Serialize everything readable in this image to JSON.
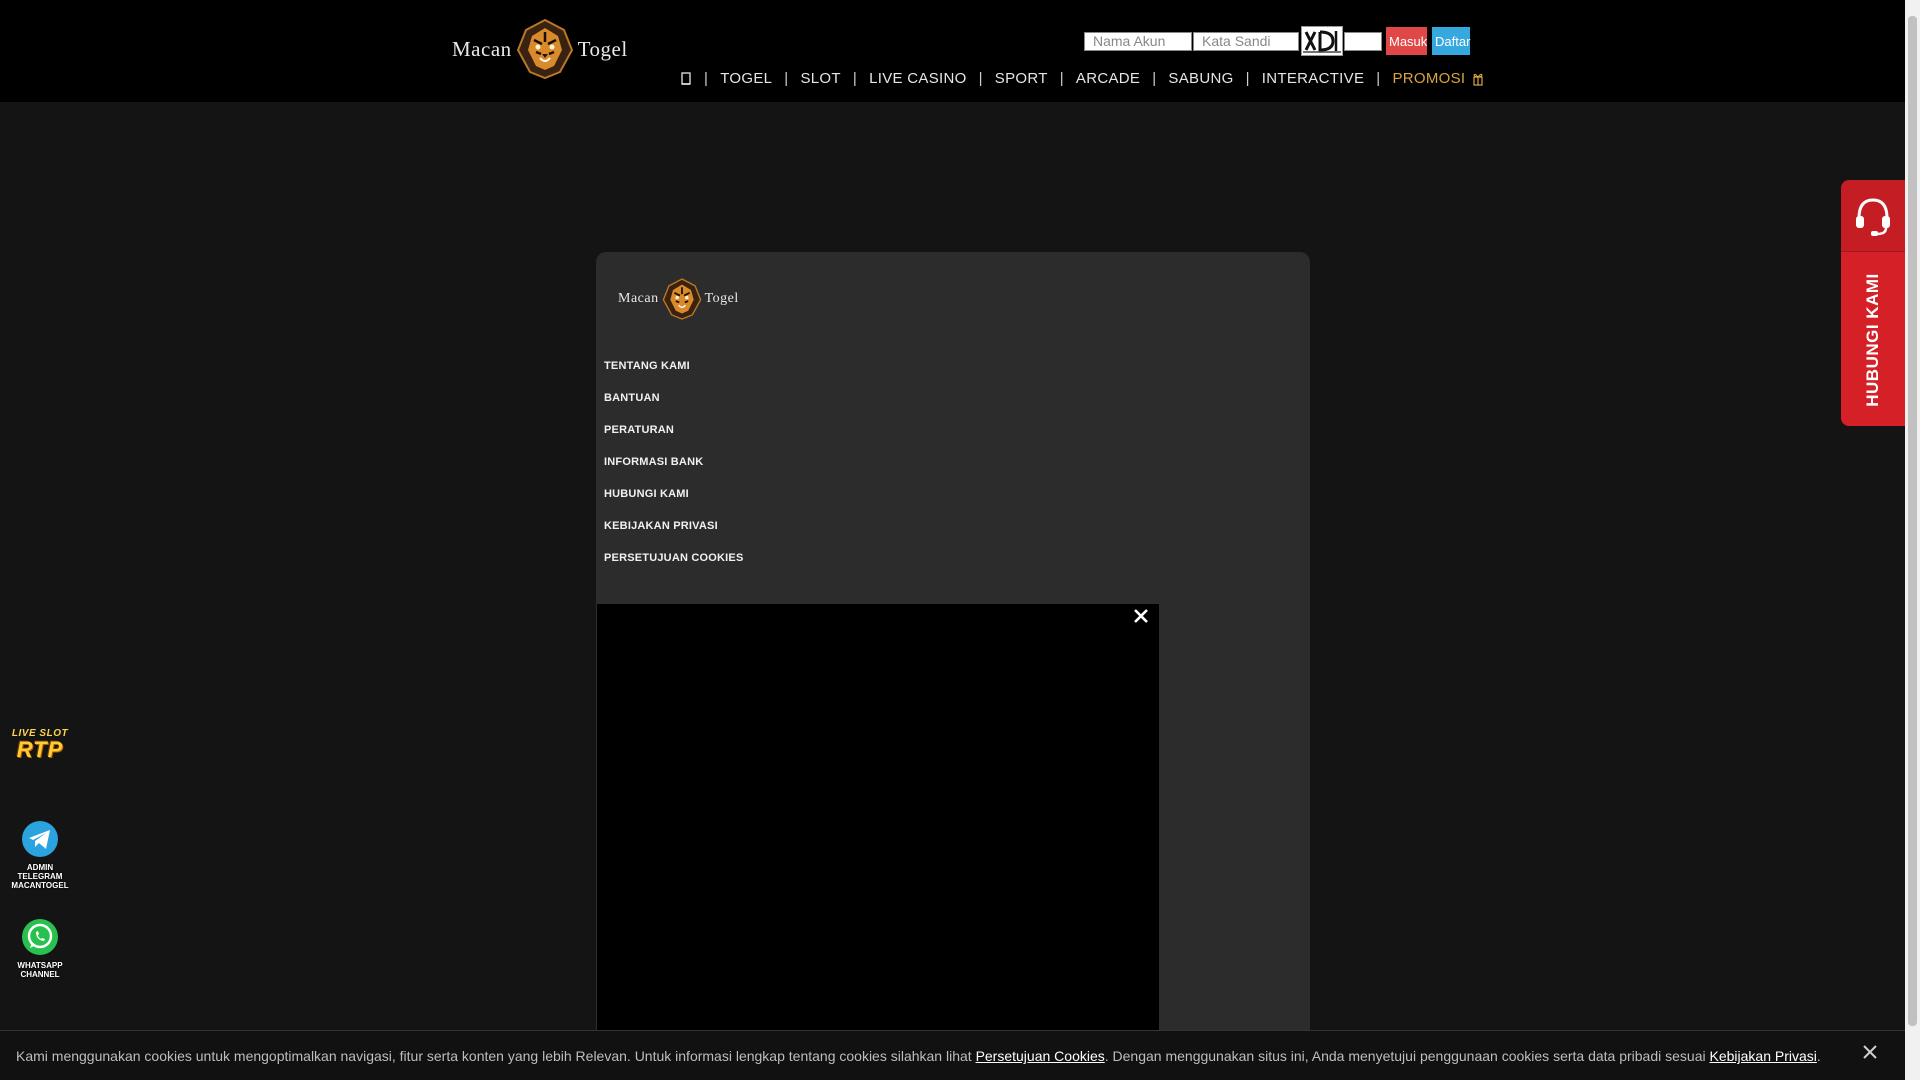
{
  "header": {
    "logo_left": "Macan",
    "logo_right": "Togel",
    "username_placeholder": "Nama Akun",
    "password_placeholder": "Kata Sandi",
    "login_label": "Masuk",
    "register_label": "Daftar"
  },
  "nav": {
    "items": [
      "TOGEL",
      "SLOT",
      "LIVE CASINO",
      "SPORT",
      "ARCADE",
      "SABUNG",
      "INTERACTIVE"
    ],
    "promo": "PROMOSI",
    "separator": "|"
  },
  "footer": {
    "logo_left": "Macan",
    "logo_right": "Togel",
    "links": [
      "TENTANG KAMI",
      "BANTUAN",
      "PERATURAN",
      "INFORMASI BANK",
      "HUBUNGI KAMI",
      "KEBIJAKAN PRIVASI",
      "PERSETUJUAN COOKIES"
    ]
  },
  "contact": {
    "label": "HUBUNGI KAMI"
  },
  "badges": {
    "rtp_top": "LIVE SLOT",
    "rtp_big": "RTP",
    "telegram_lines": [
      "ADMIN",
      "TELEGRAM",
      "MACANTOGEL"
    ],
    "whatsapp_lines": [
      "WHATSAPP",
      "CHANNEL"
    ]
  },
  "cookie": {
    "text_1": "Kami menggunakan cookies untuk mengoptimalkan navigasi, fitur serta konten yang lebih Relevan. Untuk informasi lengkap tentang cookies silahkan lihat ",
    "link_1": "Persetujuan Cookies",
    "text_2": ". Dengan menggunakan situs ini, Anda menyetujui penggunaan cookies serta data pribadi sesuai ",
    "link_2": "Kebijakan Privasi",
    "text_3": "."
  },
  "colors": {
    "login_button": "#e14747",
    "register_button": "#36a8e0",
    "promo_link": "#d9a441",
    "contact_panel": "#d62027"
  }
}
